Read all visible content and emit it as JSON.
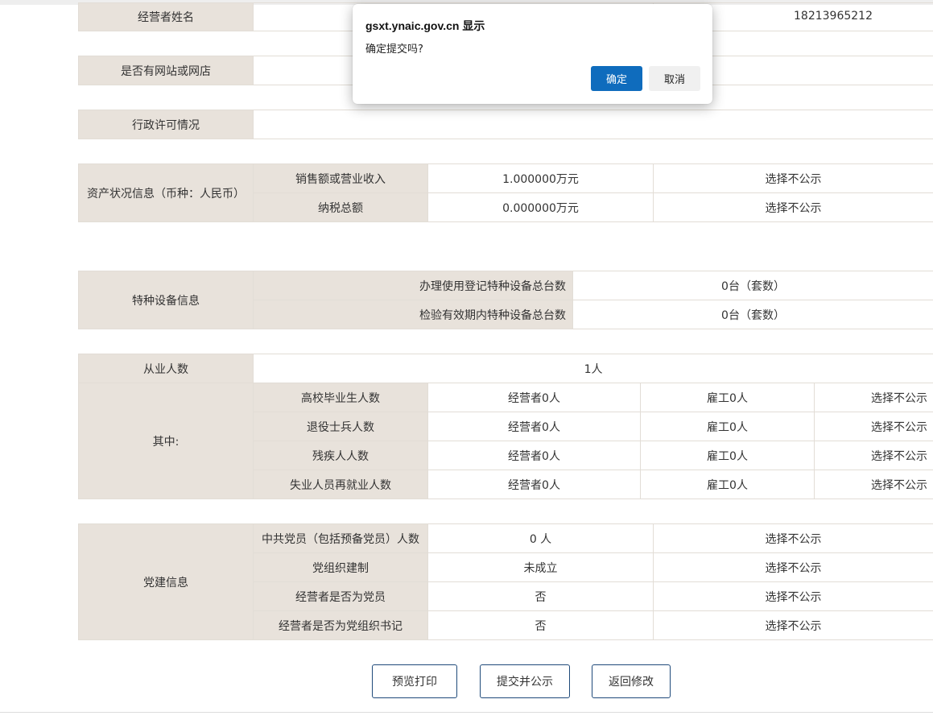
{
  "operator": {
    "name_label": "经营者姓名",
    "phone": "18213965212",
    "website_label": "是否有网站或网店",
    "license_label": "行政许可情况"
  },
  "assets": {
    "label": "资产状况信息（币种：人民币）",
    "rows": [
      {
        "label": "销售额或营业收入",
        "value": "1.000000万元",
        "visibility": "选择不公示"
      },
      {
        "label": "纳税总额",
        "value": "0.000000万元",
        "visibility": "选择不公示"
      }
    ]
  },
  "equipment": {
    "label": "特种设备信息",
    "rows": [
      {
        "label": "办理使用登记特种设备总台数",
        "value": "0台（套数）"
      },
      {
        "label": "检验有效期内特种设备总台数",
        "value": "0台（套数）"
      }
    ]
  },
  "employees": {
    "total_label": "从业人数",
    "total_value": "1人",
    "among_label": "其中:",
    "rows": [
      {
        "label": "高校毕业生人数",
        "operator": "经营者0人",
        "employee": "雇工0人",
        "visibility": "选择不公示"
      },
      {
        "label": "退役士兵人数",
        "operator": "经营者0人",
        "employee": "雇工0人",
        "visibility": "选择不公示"
      },
      {
        "label": "残疾人人数",
        "operator": "经营者0人",
        "employee": "雇工0人",
        "visibility": "选择不公示"
      },
      {
        "label": "失业人员再就业人数",
        "operator": "经营者0人",
        "employee": "雇工0人",
        "visibility": "选择不公示"
      }
    ]
  },
  "party": {
    "label": "党建信息",
    "rows": [
      {
        "label": "中共党员（包括预备党员）人数",
        "value": "0 人",
        "visibility": "选择不公示"
      },
      {
        "label": "党组织建制",
        "value": "未成立",
        "visibility": "选择不公示"
      },
      {
        "label": "经营者是否为党员",
        "value": "否",
        "visibility": "选择不公示"
      },
      {
        "label": "经营者是否为党组织书记",
        "value": "否",
        "visibility": "选择不公示"
      }
    ]
  },
  "actions": {
    "preview": "预览打印",
    "submit": "提交并公示",
    "back": "返回修改"
  },
  "dialog": {
    "title": "gsxt.ynaic.gov.cn 显示",
    "message": "确定提交吗?",
    "ok": "确定",
    "cancel": "取消"
  },
  "colors": {
    "label_bg": "#e8e2db",
    "dialog_ok_bg": "#0f6cbd",
    "button_border": "#1f4a7a"
  }
}
